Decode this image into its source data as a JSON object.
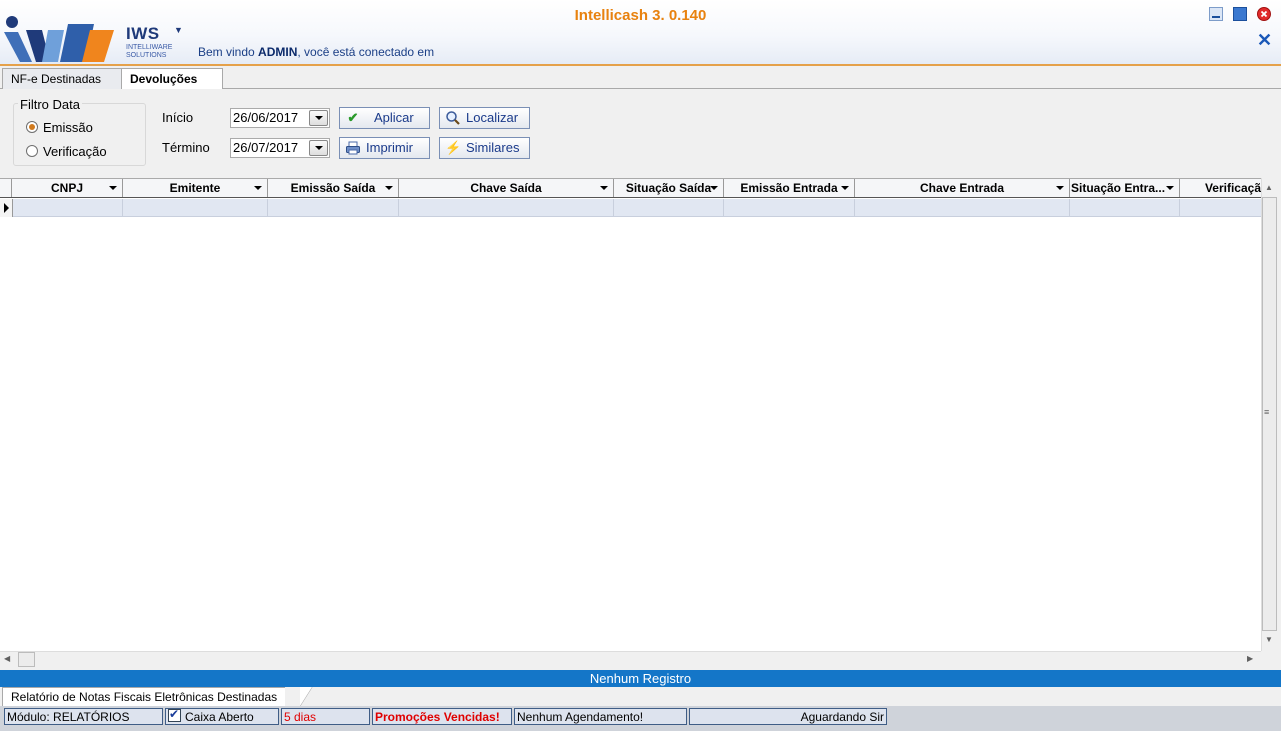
{
  "header": {
    "app_title": "Intellicash 3. 0.140",
    "logo_brand": "IWS",
    "logo_subtitle": "INTELLIWARE SOLUTIONS",
    "welcome_prefix": "Bem vindo ",
    "welcome_user": "ADMIN",
    "welcome_suffix": ", você está conectado em",
    "icons": [
      "minimize-icon",
      "maximize-icon",
      "close-icon",
      "close-x-icon"
    ],
    "colors": {
      "title": "#e8820f",
      "brand_blue": "#1f3a7a",
      "logo_orange": "#f0851d"
    }
  },
  "tabs": [
    {
      "label": "NF-e Destinadas",
      "active": false
    },
    {
      "label": "Devoluções",
      "active": true
    }
  ],
  "filter": {
    "group_title": "Filtro Data",
    "radio_options": [
      {
        "label": "Emissão",
        "selected": true
      },
      {
        "label": "Verificação",
        "selected": false
      }
    ],
    "start_label": "Início",
    "start_value": "26/06/2017",
    "end_label": "Término",
    "end_value": "26/07/2017",
    "buttons": {
      "apply": "Aplicar",
      "find": "Localizar",
      "print": "Imprimir",
      "similar": "Similares"
    }
  },
  "grid": {
    "columns": [
      "CNPJ",
      "Emitente",
      "Emissão Saída",
      "Chave Saída",
      "Situação Saída",
      "Emissão Entrada",
      "Chave Entrada",
      "Situação Entra...",
      "Verificaçã"
    ]
  },
  "footer": {
    "record_status": "Nenhum Registro",
    "report_tab": "Relatório de Notas Fiscais Eletrônicas Destinadas",
    "status_items": {
      "module": "Módulo: RELATÓRIOS",
      "cash": "Caixa Aberto",
      "days": "5 dias",
      "promotions": "Promoções Vencidas!",
      "schedule": "Nenhum Agendamento!",
      "waiting": "Aguardando Sir"
    },
    "colors": {
      "status_blue": "#1476c8",
      "alert_red": "#e00000"
    }
  }
}
